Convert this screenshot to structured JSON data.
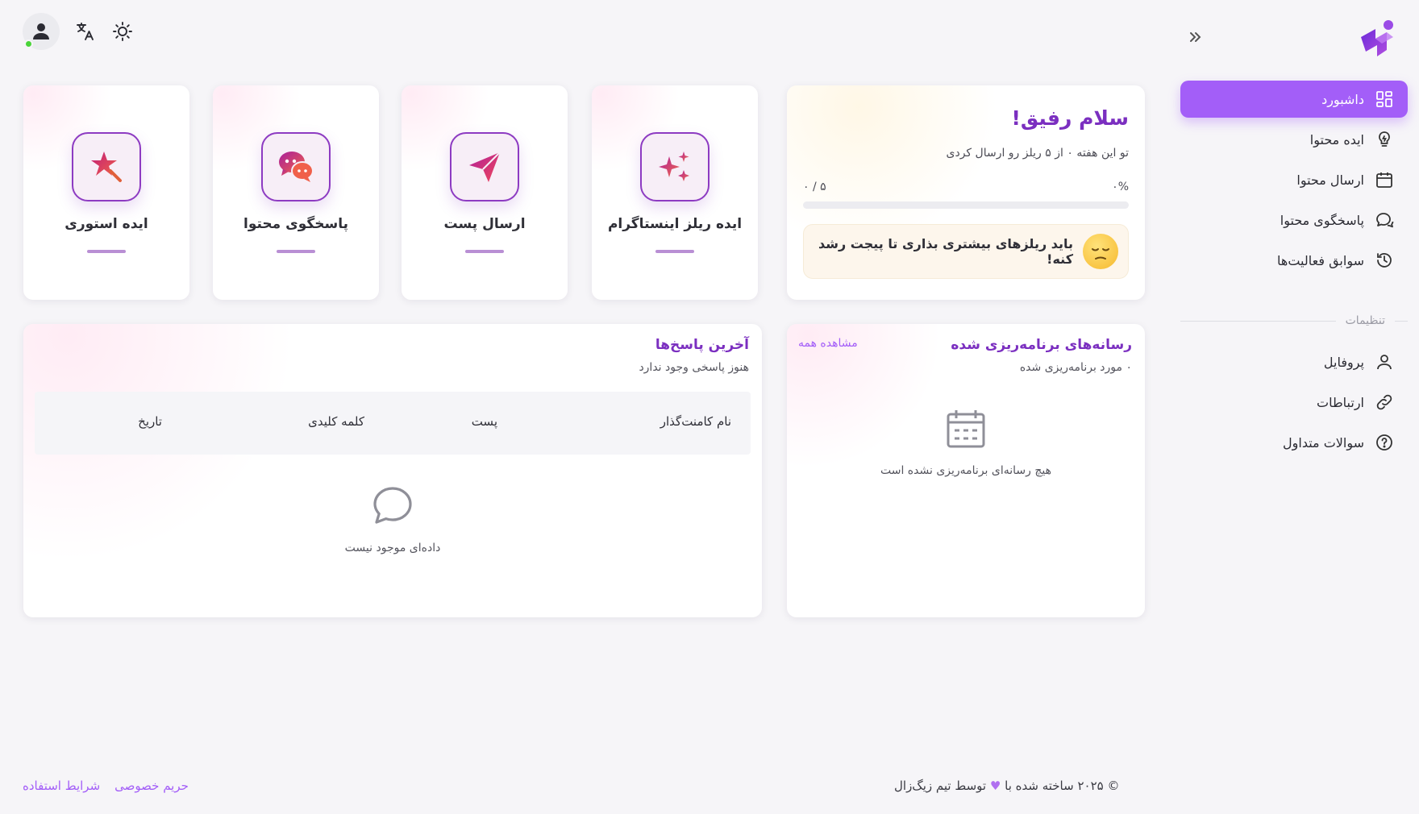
{
  "sidebar": {
    "items": [
      {
        "label": "داشبورد"
      },
      {
        "label": "ایده محتوا"
      },
      {
        "label": "ارسال محتوا"
      },
      {
        "label": "پاسخگوی محتوا"
      },
      {
        "label": "سوابق فعالیت‌ها"
      }
    ],
    "section_label": "تنظیمات",
    "settings_items": [
      {
        "label": "پروفایل"
      },
      {
        "label": "ارتباطات"
      },
      {
        "label": "سوالات متداول"
      }
    ]
  },
  "greeting": {
    "title": "سلام رفیق!",
    "subtitle": "تو این هفته ۰ از ۵ ریلز رو ارسال کردی",
    "progress_percent": "۰%",
    "progress_count": "۰ / ۵",
    "progress_fraction": 0,
    "alert": "باید ریلزهای بیشتری بذاری تا پیجت رشد کنه!"
  },
  "quick_actions": [
    {
      "label": "ایده ریلز اینستاگرام",
      "icon": "sparkles-icon"
    },
    {
      "label": "ارسال پست",
      "icon": "paper-plane-icon"
    },
    {
      "label": "پاسخگوی محتوا",
      "icon": "chat-bubbles-icon"
    },
    {
      "label": "ایده استوری",
      "icon": "star-wand-icon"
    }
  ],
  "scheduled": {
    "title": "رسانه‌های برنامه‌ریزی شده",
    "subtitle": "۰ مورد برنامه‌ریزی شده",
    "see_all": "مشاهده همه",
    "empty": "هیچ رسانه‌ای برنامه‌ریزی نشده است"
  },
  "responses": {
    "title": "آخرین پاسخ‌ها",
    "subtitle": "هنوز پاسخی وجود ندارد",
    "columns": [
      "نام کامنت‌گذار",
      "پست",
      "کلمه کلیدی",
      "تاریخ"
    ],
    "empty": "داده‌ای موجود نیست"
  },
  "footer": {
    "copy_before": "© ۲۰۲۵ ساخته شده با",
    "copy_after": "توسط تیم زیگ‌زال",
    "links": [
      "حریم خصوصی",
      "شرایط استفاده"
    ]
  },
  "colors": {
    "accent": "#a35ef8",
    "title": "#7b2fc0",
    "online": "#4ad439"
  }
}
